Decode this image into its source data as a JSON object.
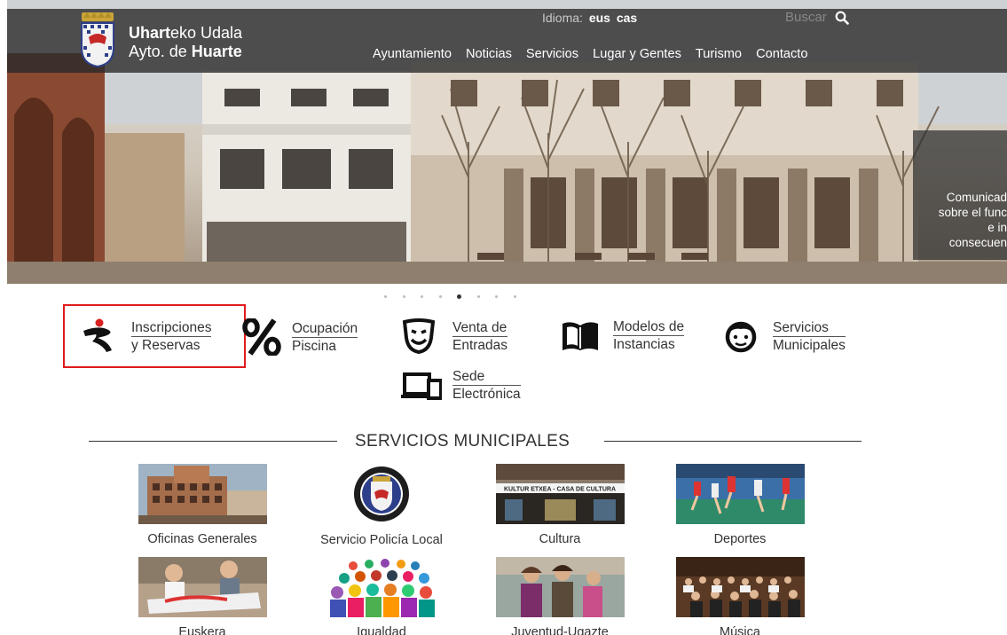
{
  "header": {
    "brand_line1_bold": "Uhart",
    "brand_line1_rest": "eko Udala",
    "brand_line2_rest": "Ayto. de ",
    "brand_line2_bold": "Huarte",
    "lang_label": "Idioma:",
    "lang_options": [
      "eus",
      "cas"
    ],
    "search_placeholder": "Buscar",
    "nav": [
      "Ayuntamiento",
      "Noticias",
      "Servicios",
      "Lugar y Gentes",
      "Turismo",
      "Contacto"
    ]
  },
  "hero": {
    "news_lines": [
      "Comunicad",
      "sobre el func",
      "e in",
      "consecuen"
    ],
    "slides": 9,
    "active_slide": 5
  },
  "quick_links": [
    {
      "line1": "Inscripciones",
      "line2": "y Reservas",
      "icon": "runner-icon"
    },
    {
      "line1": "Ocupación",
      "line2": "Piscina",
      "icon": "percent-icon"
    },
    {
      "line1": "Venta de",
      "line2": "Entradas",
      "icon": "theater-mask-icon"
    },
    {
      "line1": "Modelos de",
      "line2": "Instancias",
      "icon": "open-book-icon"
    },
    {
      "line1": "Servicios",
      "line2": "Municipales",
      "icon": "support-agent-icon"
    },
    {
      "line1": "Sede",
      "line2": "Electrónica",
      "icon": "devices-icon"
    }
  ],
  "services_section": {
    "title": "SERVICIOS MUNICIPALES",
    "items": [
      {
        "label": "Oficinas Generales"
      },
      {
        "label": "Servicio Policía Local"
      },
      {
        "label": "Cultura"
      },
      {
        "label": "Deportes"
      },
      {
        "label": "Euskera"
      },
      {
        "label": "Igualdad"
      },
      {
        "label": "Juventud-Ugazte"
      },
      {
        "label": "Música"
      }
    ],
    "cultura_sign_text": "KULTUR ETXEA - CASA DE CULTURA"
  },
  "colors": {
    "highlight_border": "#e01b1b",
    "topbar_bg": "#282828",
    "accent_red": "#d81e1e"
  }
}
